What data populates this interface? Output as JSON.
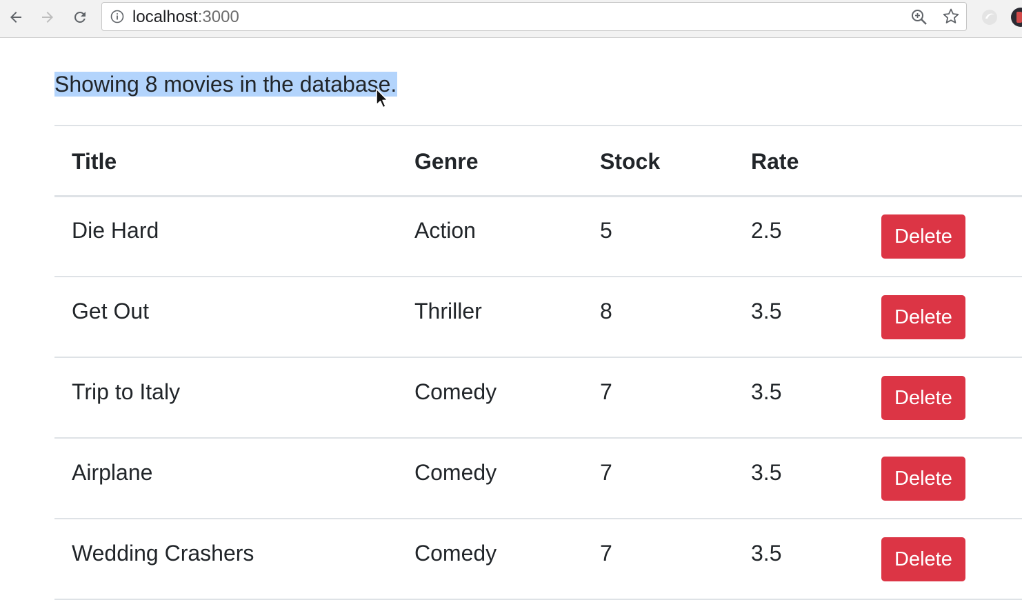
{
  "browser": {
    "url_host": "localhost",
    "url_port": ":3000"
  },
  "page": {
    "summary_text": "Showing 8 movies in the database."
  },
  "table": {
    "headers": {
      "title": "Title",
      "genre": "Genre",
      "stock": "Stock",
      "rate": "Rate"
    },
    "delete_label": "Delete",
    "rows": [
      {
        "title": "Die Hard",
        "genre": "Action",
        "stock": "5",
        "rate": "2.5"
      },
      {
        "title": "Get Out",
        "genre": "Thriller",
        "stock": "8",
        "rate": "3.5"
      },
      {
        "title": "Trip to Italy",
        "genre": "Comedy",
        "stock": "7",
        "rate": "3.5"
      },
      {
        "title": "Airplane",
        "genre": "Comedy",
        "stock": "7",
        "rate": "3.5"
      },
      {
        "title": "Wedding Crashers",
        "genre": "Comedy",
        "stock": "7",
        "rate": "3.5"
      }
    ]
  },
  "colors": {
    "danger": "#dc3545",
    "selection": "#b3d4fc"
  },
  "icons": [
    "back-icon",
    "forward-icon",
    "reload-icon",
    "info-icon",
    "zoom-icon",
    "star-icon",
    "extension-icon",
    "profile-avatar",
    "cursor-icon"
  ]
}
